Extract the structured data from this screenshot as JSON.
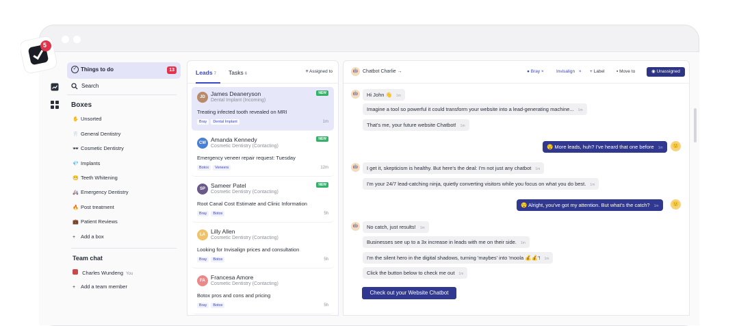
{
  "app": {
    "notification_count": "5"
  },
  "sidebar": {
    "todo": {
      "label": "Things to do",
      "badge": "13"
    },
    "search": {
      "label": "Search"
    },
    "boxes_title": "Boxes",
    "boxes": [
      {
        "emoji": "✋",
        "label": "Unsorted"
      },
      {
        "emoji": "🦷",
        "label": "General Dentistry"
      },
      {
        "emoji": "🕶",
        "label": "Cosmetic Dentistry"
      },
      {
        "emoji": "💎",
        "label": "Implants"
      },
      {
        "emoji": "😁",
        "label": "Teeth Whitening"
      },
      {
        "emoji": "🚑",
        "label": "Emergency Dentistry"
      },
      {
        "emoji": "🔥",
        "label": "Post treatment"
      },
      {
        "emoji": "💼",
        "label": "Patient Reviews"
      },
      {
        "emoji": "+",
        "label": "Add a box"
      }
    ],
    "team_chat_title": "Team chat",
    "team_member": {
      "name": "Charles Wundeng",
      "suffix": "You"
    },
    "add_member": "Add a team member"
  },
  "leads_panel": {
    "tabs": [
      {
        "label": "Leads",
        "count": "7"
      },
      {
        "label": "Tasks",
        "count": "6"
      }
    ],
    "assigned_label": "Assigned to",
    "leads": [
      {
        "name": "James Deaneryson",
        "subtitle": "Dental Implant (Incoming)",
        "message": "Treating infected tooth revealed on MRI",
        "tags": [
          "Bray",
          "Dental Implant"
        ],
        "time": "1m",
        "new": "NEW",
        "initials": "JD",
        "avatar_color": "#b98a6a"
      },
      {
        "name": "Amanda Kennedy",
        "subtitle": "Cosmetic Dentistry (Contacting)",
        "message": "Emergency veneer repair request: Tuesday",
        "tags": [
          "Botox",
          "Veneers"
        ],
        "time": "12m",
        "new": "NEW",
        "initials": "CW",
        "avatar_color": "#4a7fd6"
      },
      {
        "name": "Sameer Patel",
        "subtitle": "Cosmetic Dentistry (Contacting)",
        "message": "Root Canal Cost Estimate and Clinic Information",
        "tags": [
          "Bray",
          "Botox"
        ],
        "time": "5h",
        "new": "NEW",
        "initials": "SP",
        "avatar_color": "#6a5a8a"
      },
      {
        "name": "Lilly Allen",
        "subtitle": "Cosmetic Dentistry (Contacting)",
        "message": "Looking for Invisalign prices and consultation",
        "tags": [
          "Bray",
          "Botox"
        ],
        "time": "5h",
        "new": "",
        "initials": "LA",
        "avatar_color": "#f0c26a"
      },
      {
        "name": "Francesa Amore",
        "subtitle": "Cosmetic Dentistry (Contacting)",
        "message": "Botox pros and cons and pricing",
        "tags": [
          "Bray",
          "Botox"
        ],
        "time": "5h",
        "new": "",
        "initials": "FA",
        "avatar_color": "#e88a8a"
      }
    ]
  },
  "chat": {
    "header": {
      "bot_name": "Chatbot Charlie",
      "tag1": "Bray",
      "tag2": "Invisalign",
      "label_btn": "Label",
      "move_btn": "Move to",
      "unassigned_btn": "Unassigned"
    },
    "messages": [
      {
        "text": "Hi John 👋",
        "time": "1m"
      },
      {
        "text": "Imagine a tool so powerful it could transform your website into a lead-generating machine...",
        "time": "1m"
      },
      {
        "text": "That's me, your future website Chatbot!",
        "time": "1m"
      },
      {
        "text": "😯 More leads, huh? I've heard that one before",
        "time": "1m"
      },
      {
        "text": "I get it, skepticism is healthy. But here's the deal: I'm not just any chatbot",
        "time": "1m"
      },
      {
        "text": "I'm your 24/7 lead-catching ninja, quietly converting visitors while you focus on what you do best.",
        "time": "1m"
      },
      {
        "text": "😯 Alright, you've got my attention. But what's the catch?",
        "time": "1m"
      },
      {
        "text": "No catch, just results!",
        "time": "1m"
      },
      {
        "text": "Businesses see up to a 3x increase in leads with me on their side.",
        "time": "1m"
      },
      {
        "text": "I'm the silent hero in the digital shadows, turning 'maybes' into 'moola 💰💰'!",
        "time": "1m"
      },
      {
        "text": "Click the button below to check me out",
        "time": "1m"
      }
    ],
    "cta": "Check out your Website Chatbot"
  }
}
